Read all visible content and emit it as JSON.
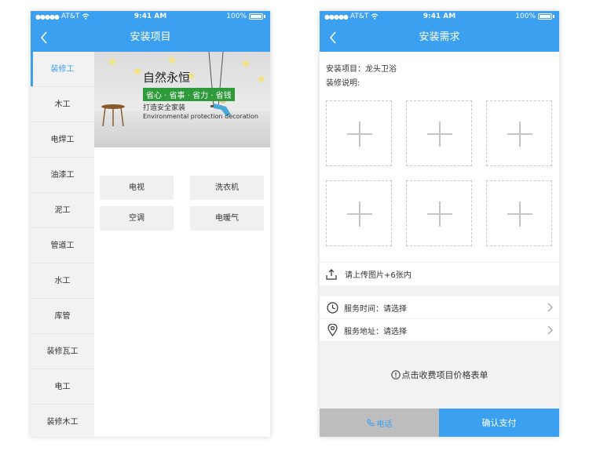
{
  "status_bar": {
    "carrier": "AT&T",
    "time": "9:41 AM",
    "battery": "100%"
  },
  "screen_a": {
    "title": "安装项目",
    "sidebar": [
      {
        "label": "装修工",
        "active": true
      },
      {
        "label": "木工"
      },
      {
        "label": "电焊工"
      },
      {
        "label": "油漆工"
      },
      {
        "label": "泥工"
      },
      {
        "label": "管道工"
      },
      {
        "label": "水工"
      },
      {
        "label": "库管"
      },
      {
        "label": "装修瓦工"
      },
      {
        "label": "电工"
      },
      {
        "label": "装修木工"
      }
    ],
    "banner": {
      "title": "自然永恒",
      "tagline": "省心 · 省事 · 省力 · 省钱",
      "subtitle": "打造安全家装",
      "english": "Environmental protection decoration"
    },
    "categories": [
      "电视",
      "洗衣机",
      "空调",
      "电暖气"
    ]
  },
  "screen_b": {
    "title": "安装需求",
    "project_line": "安装项目：龙头卫浴",
    "note_label": "装修说明:",
    "photo_slots": 6,
    "upload_text": "请上传图片+6张内",
    "service_time": "服务时间：请选择",
    "service_address": "服务地址：请选择",
    "price_link": "点击收费项目价格表单",
    "phone_button": "电话",
    "pay_button": "确认支付"
  },
  "colors": {
    "accent": "#3ba0f0",
    "phone_button_bg": "#bdbdbd",
    "banner_green": "#2e9a3a"
  },
  "icons": [
    "back-chevron-icon",
    "wifi-icon",
    "battery-icon",
    "plus-icon",
    "upload-icon",
    "clock-icon",
    "location-pin-icon",
    "chevron-right-icon",
    "info-circle-icon",
    "phone-icon"
  ]
}
